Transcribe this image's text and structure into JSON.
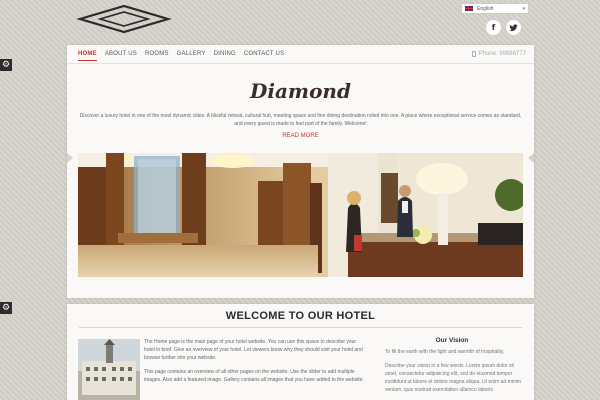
{
  "header": {
    "language": "English",
    "social": [
      "facebook-icon",
      "twitter-icon"
    ]
  },
  "nav": {
    "items": [
      {
        "label": "HOME",
        "active": true
      },
      {
        "label": "ABOUT US"
      },
      {
        "label": "ROOMS"
      },
      {
        "label": "GALLERY"
      },
      {
        "label": "DINING"
      },
      {
        "label": "CONTACT US"
      }
    ],
    "phone": "Phone: 99888777"
  },
  "hero": {
    "title": "Diamond",
    "intro": "Discover a luxury hotel in one of the most dynamic cities. A blissful retreat, cultural hub, meeting space and fine dining destination rolled into one. A place where exceptional service comes as standard, and every guest is made to feel part of the family. Welcome!",
    "read_more": "READ MORE"
  },
  "welcome": {
    "heading": "WELCOME TO OUR HOTEL",
    "p1": "The Home page is the main page of your hotel website. You can use this space to describe your hotel in brief. Give an overview of your hotel. Let viewers know why they should visit your hotel and browse further into your website.",
    "p2": "This page contains an overview of all other pages on the website. Use the slider to add multiple images. Also add a featured image. Gallery contains all images that you have added to the website."
  },
  "vision": {
    "heading": "Our Vision",
    "p1": "To fill the earth with the light and warmth of hospitality.",
    "p2": "Describe your vision in a few words. Lorem ipsum dolor sit amet, consectetur adipisicing elit, sed do eiusmod tempor incididunt ut labore et dolore magna aliqua. Ut enim ad minim veniam, quis nostrud exercitation ullamco laboris"
  },
  "colors": {
    "accent": "#c0392b",
    "background": "#d6d1cb"
  }
}
